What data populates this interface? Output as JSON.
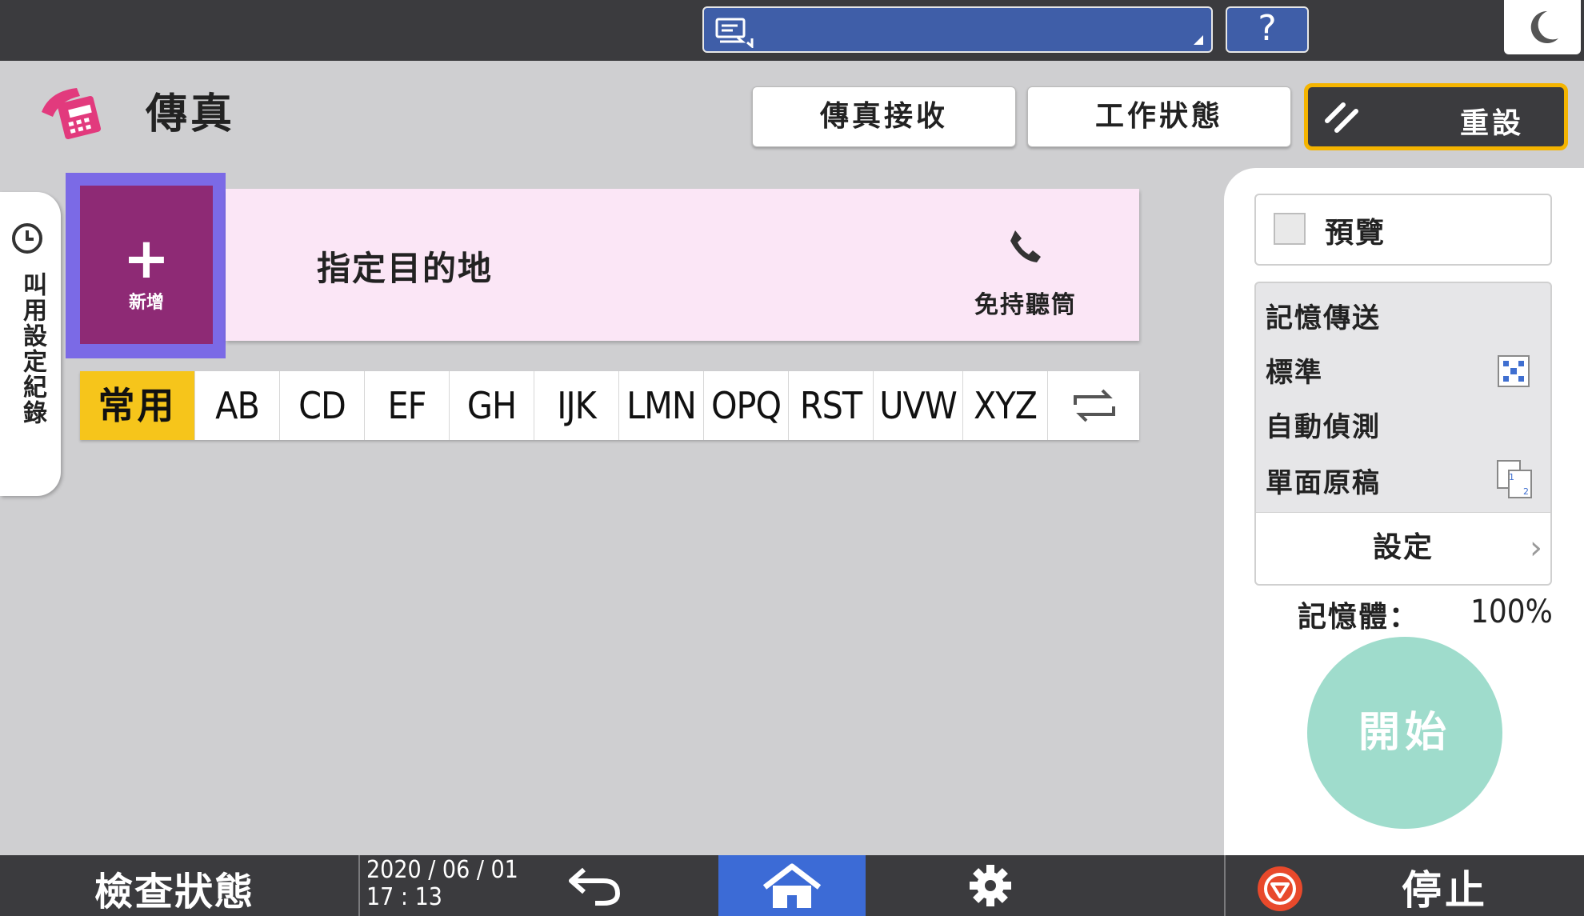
{
  "app": {
    "title": "傳真"
  },
  "header": {
    "fax_receive": "傳真接收",
    "job_status": "工作狀態",
    "reset": "重設"
  },
  "top": {
    "help": "?"
  },
  "history_tab": {
    "label": "叫用設定紀錄"
  },
  "destination": {
    "add_label": "新增",
    "prompt": "指定目的地",
    "handsfree": "免持聽筒"
  },
  "index_tabs": [
    "常用",
    "AB",
    "CD",
    "EF",
    "GH",
    "IJK",
    "LMN",
    "OPQ",
    "RST",
    "UVW",
    "XYZ"
  ],
  "right_panel": {
    "preview": "預覽",
    "preview_checked": false,
    "memory_transmission": "記憶傳送",
    "resolution": "標準",
    "density": "自動偵測",
    "original": "單面原稿",
    "settings": "設定",
    "memory_label": "記憶體：",
    "memory_value": "100%",
    "start": "開始"
  },
  "bottom": {
    "check_status": "檢查狀態",
    "date": "2020 / 06 / 01",
    "time": "17 : 13",
    "stop": "停止"
  },
  "colors": {
    "accent_blue": "#3f5ea8",
    "reset_border": "#f4b400",
    "add_button": "#8e2a75",
    "active_tab": "#f6c51b",
    "start_button": "#9fdccc",
    "home_active": "#3c6bd6"
  }
}
